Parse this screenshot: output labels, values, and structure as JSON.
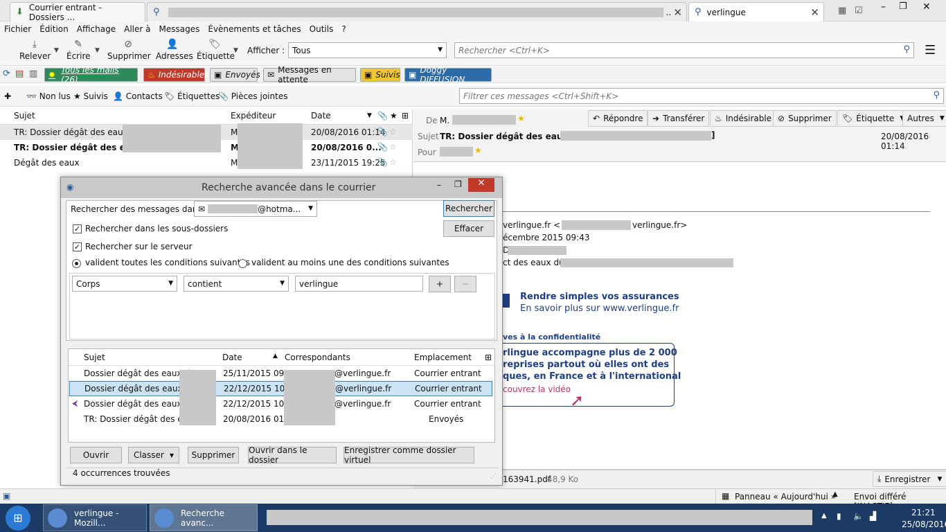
{
  "tabs": [
    {
      "label": "Courrier entrant - Dossiers ..."
    },
    {
      "label": ""
    },
    {
      "label": "verlingue"
    }
  ],
  "menu": [
    "Fichier",
    "Édition",
    "Affichage",
    "Aller à",
    "Messages",
    "Évènements et tâches",
    "Outils",
    "?"
  ],
  "toolbar": {
    "relever": "Relever",
    "ecrire": "Écrire",
    "supprimer": "Supprimer",
    "adresses": "Adresses",
    "etiquette": "Étiquette",
    "afficher_label": "Afficher :",
    "afficher_value": "Tous",
    "search_placeholder": "Rechercher <Ctrl+K>"
  },
  "folders": [
    "Tous les mails (26)",
    "Indésirables",
    "Envoyés",
    "Messages en attente",
    "Suivis",
    "Doggy DIFFUSION"
  ],
  "quickfilter": {
    "nonlus": "Non lus",
    "suivis": "Suivis",
    "contacts": "Contacts",
    "etiquettes": "Étiquettes",
    "pj": "Pièces jointes",
    "placeholder": "Filtrer ces messages <Ctrl+Shift+K>"
  },
  "thread": {
    "headers": {
      "sujet": "Sujet",
      "exp": "Expéditeur",
      "date": "Date"
    },
    "rows": [
      {
        "subject": "TR: Dossier dégât des eaux du",
        "from": "M",
        "date": "20/08/2016 01:14"
      },
      {
        "subject": "TR: Dossier dégât des eaux d",
        "from": "M",
        "date": "20/08/2016 0..."
      },
      {
        "subject": "Dégât des eaux",
        "from": "M",
        "date": "23/11/2015 19:25"
      }
    ]
  },
  "message": {
    "de_label": "De",
    "de_value": "M.",
    "sujet_label": "Sujet",
    "sujet_value": "TR: Dossier dégât des eaux du (",
    "pour_label": "Pour",
    "date": "20/08/2016 01:14",
    "buttons": {
      "repondre": "Répondre",
      "transferer": "Transférer",
      "indesirable": "Indésirable",
      "supprimer": "Supprimer",
      "etiquette": "Étiquette",
      "autres": "Autres"
    },
    "body": {
      "line1a": "verlingue.fr <",
      "line1b": "verlingue.fr>",
      "line2": "écembre 2015 09:43",
      "line3": "Df",
      "line4": "ct des eaux du",
      "ad1": "Rendre simples vos assurances",
      "ad2": "En savoir plus sur www.verlingue.fr",
      "conf": "ves à la confidentialité",
      "p1": "rlingue accompagne plus de 2 000",
      "p2": "reprises partout où elles ont des",
      "p3": "ques, en France et à l'international",
      "video": "couvrez la vidéo"
    },
    "attachment": "163941.pdf",
    "attachment_size": "48,9 Ko",
    "enregistrer": "Enregistrer"
  },
  "dialog": {
    "title": "Recherche avancée dans le courrier",
    "search_in_label": "Rechercher des messages dans :",
    "account": "@hotma...",
    "rechercher": "Rechercher",
    "effacer": "Effacer",
    "subfolders": "Rechercher dans les sous-dossiers",
    "server": "Rechercher sur le serveur",
    "all_cond": "valident toutes les conditions suivantes",
    "any_cond": "valident au moins une des conditions suivantes",
    "field": "Corps",
    "op": "contient",
    "value": "verlingue",
    "plus": "+",
    "minus": "−",
    "headers": {
      "sujet": "Sujet",
      "date": "Date",
      "corr": "Correspondants",
      "empl": "Emplacement"
    },
    "rows": [
      {
        "subject": "Dossier dégât des eaux du",
        "date": "25/11/2015 09...",
        "corr": "@verlingue.fr",
        "loc": "Courrier entrant"
      },
      {
        "subject": "Dossier dégât des eaux du",
        "date": "22/12/2015 10...",
        "corr": "@verlingue.fr",
        "loc": "Courrier entrant"
      },
      {
        "subject": "Dossier dégât des eaux du",
        "date": "22/12/2015 10...",
        "corr": "@verlingue.fr",
        "loc": "Courrier entrant"
      },
      {
        "subject": "TR: Dossier dégât des eaux",
        "date": "20/08/2016 01...",
        "corr": "",
        "loc": "Envoyés"
      }
    ],
    "ouvrir": "Ouvrir",
    "classer": "Classer",
    "supprimer": "Supprimer",
    "ouvrir_dossier": "Ouvrir dans le dossier",
    "virtuel": "Enregistrer comme dossier virtuel",
    "status": "4 occurrences trouvées"
  },
  "status": {
    "panneau": "Panneau « Aujourd'hui »",
    "envoi": "Envoi différé [INACTIF]"
  },
  "taskbar": {
    "task1": "verlingue - Mozill...",
    "task2": "Recherche avanc...",
    "time": "21:21",
    "date": "25/08/2016"
  }
}
